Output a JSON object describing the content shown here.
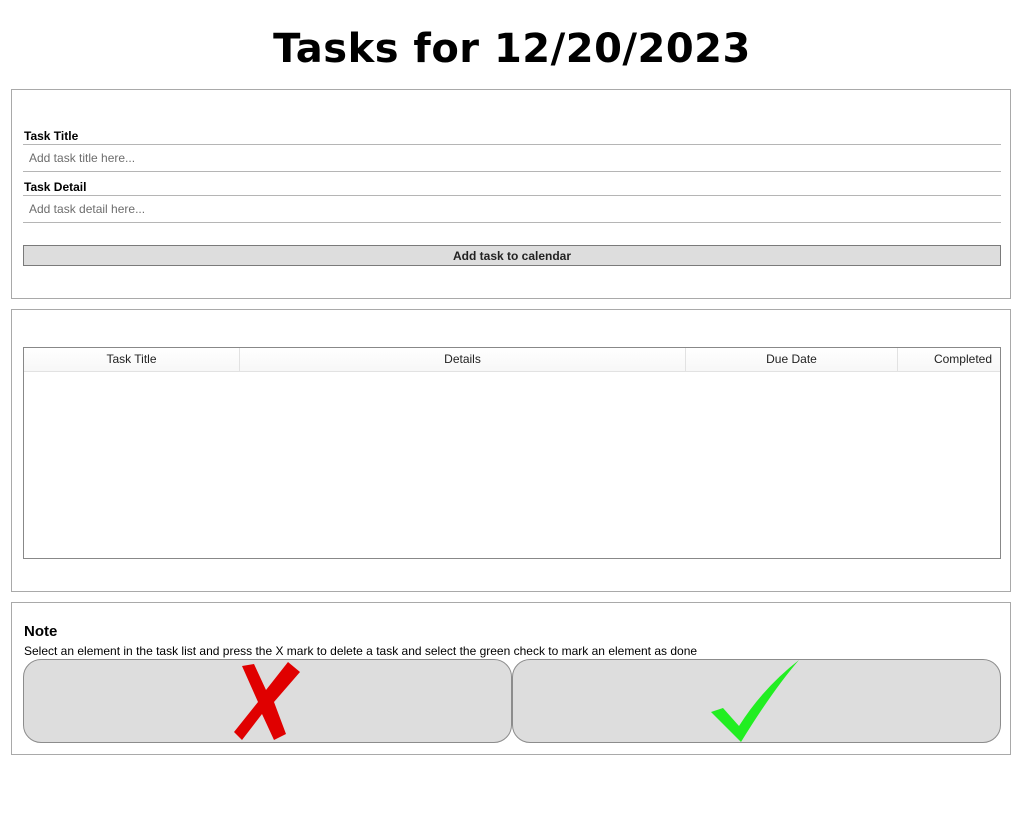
{
  "page": {
    "title": "Tasks for 12/20/2023"
  },
  "form": {
    "title_label": "Task Title",
    "title_placeholder": "Add task title here...",
    "title_value": "",
    "detail_label": "Task Detail",
    "detail_placeholder": "Add task detail here...",
    "detail_value": "",
    "add_button_label": "Add task to calendar"
  },
  "task_list": {
    "columns": [
      "Task Title",
      "Details",
      "Due Date",
      "Completed"
    ],
    "rows": []
  },
  "note": {
    "heading": "Note",
    "text": "Select an element in the task list and press the X mark to delete a task and select the green check to mark an element as done"
  },
  "actions": {
    "delete_icon": "x-mark-icon",
    "delete_color": "#e00000",
    "done_icon": "check-mark-icon",
    "done_color": "#22ee22"
  }
}
